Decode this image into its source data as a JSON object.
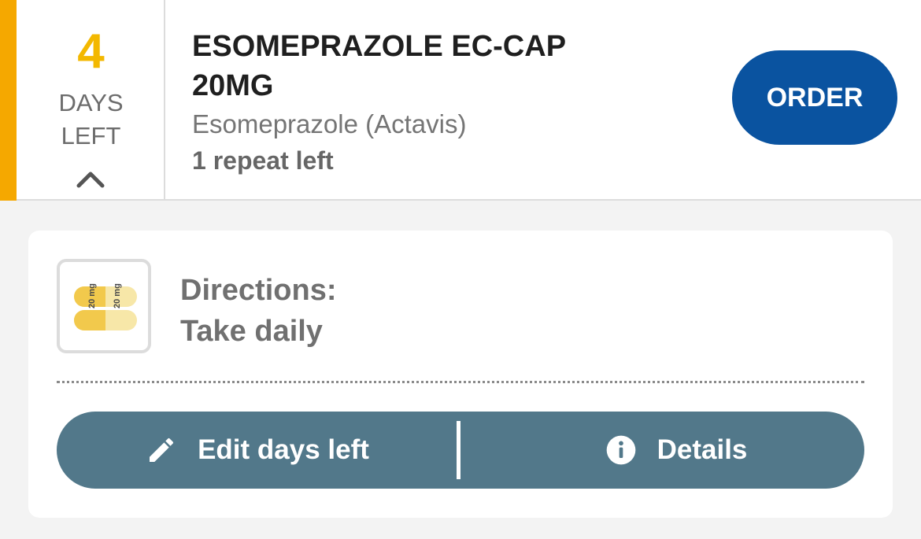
{
  "medication": {
    "days_left_count": "4",
    "days_left_label_1": "DAYS",
    "days_left_label_2": "LEFT",
    "name_line_1": "ESOMEPRAZOLE EC-CAP",
    "name_line_2": "20MG",
    "generic_name": "Esomeprazole (Actavis)",
    "repeats": "1 repeat left",
    "order_label": "ORDER",
    "pill_imprint": "20 mg"
  },
  "details": {
    "directions_heading": "Directions:",
    "directions_text": "Take daily",
    "edit_label": "Edit days left",
    "details_label": "Details"
  },
  "colors": {
    "accent": "#f5a800",
    "days_number": "#f3b800",
    "order_button": "#0a53a0",
    "action_bar": "#52788a"
  },
  "icons": {
    "collapse": "chevron-up-icon",
    "edit": "pencil-icon",
    "details": "info-icon",
    "medication": "capsule-icon"
  }
}
